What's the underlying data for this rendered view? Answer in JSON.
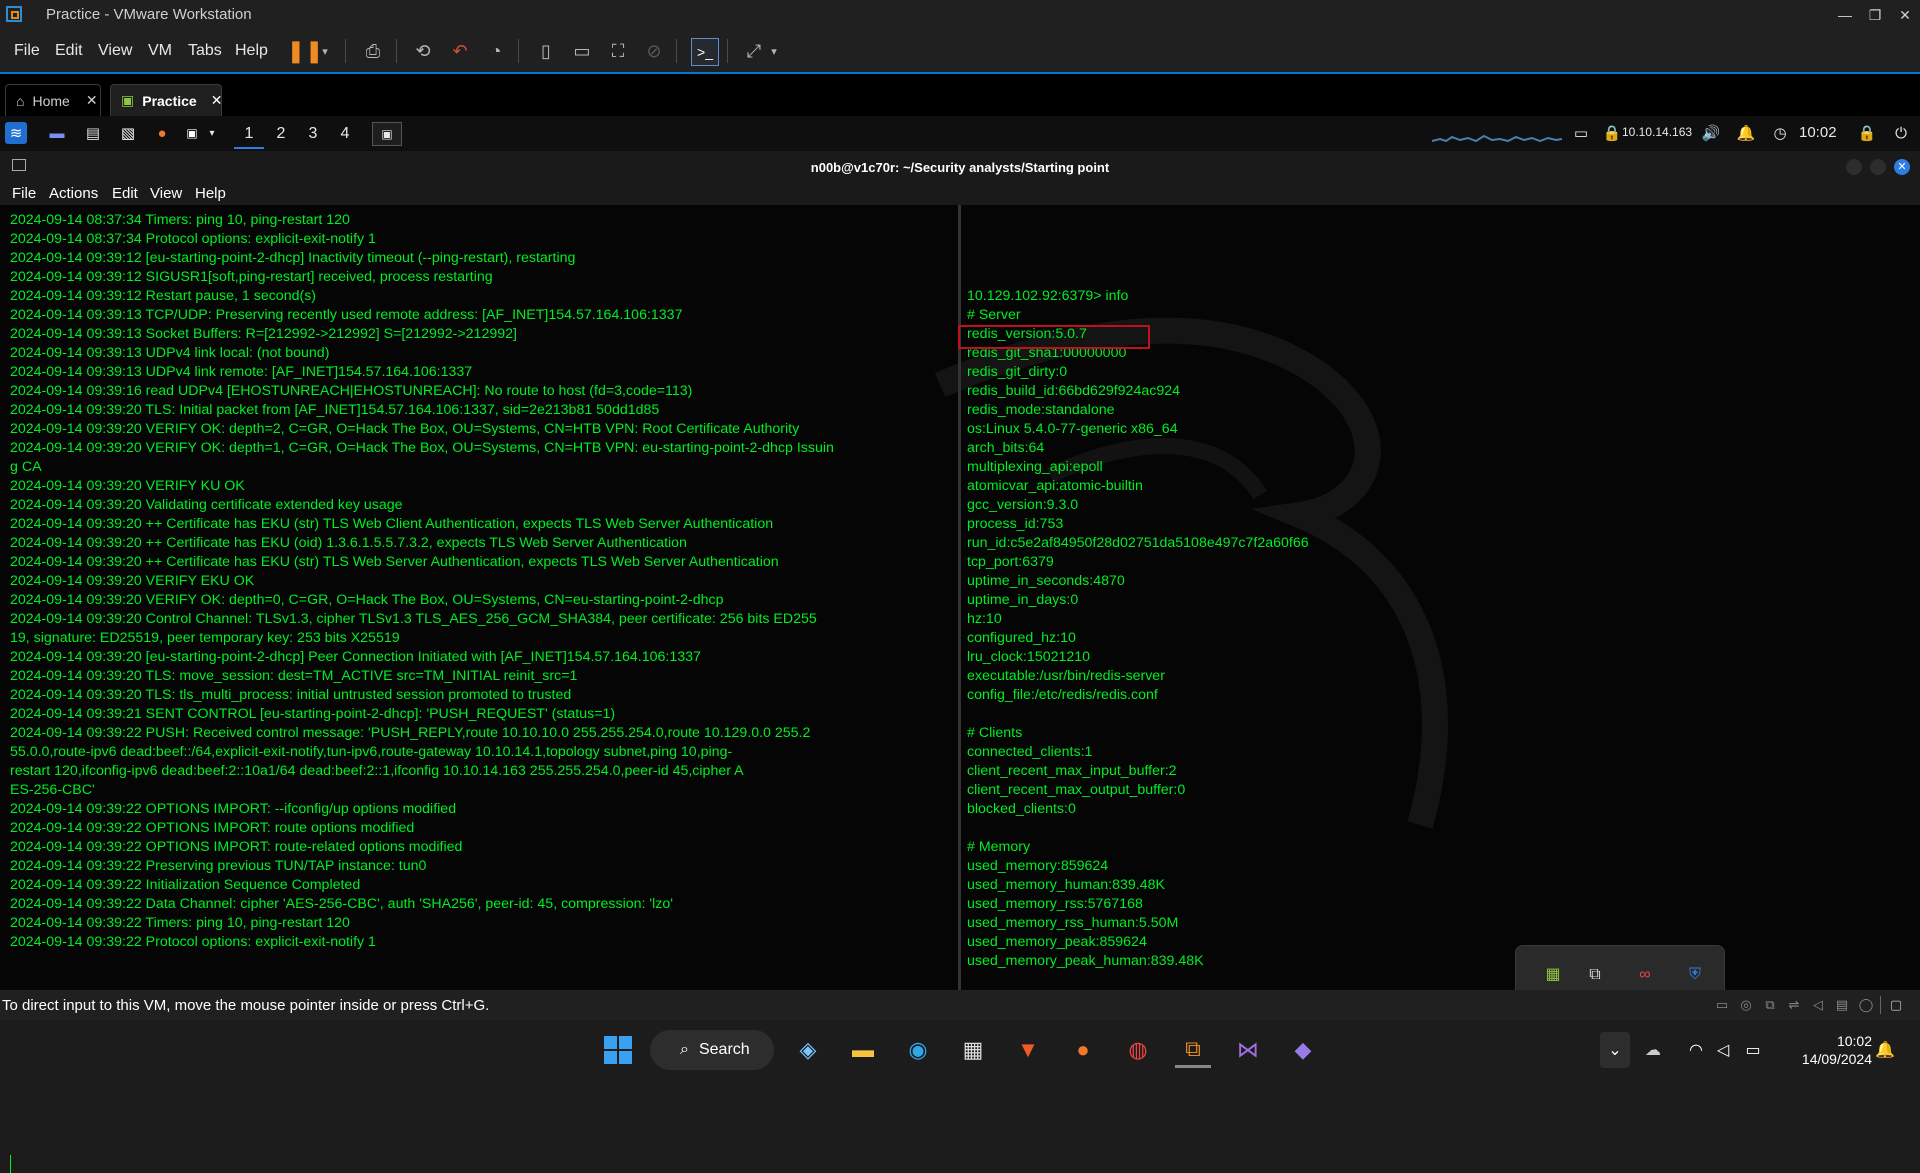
{
  "window": {
    "title": "Practice - VMware Workstation",
    "controls": [
      "—",
      "❐",
      "✕"
    ]
  },
  "vm_menu": [
    "File",
    "Edit",
    "View",
    "VM",
    "Tabs",
    "Help"
  ],
  "vm_tabs": [
    {
      "label": "Home",
      "icon": "home-icon",
      "active": false
    },
    {
      "label": "Practice",
      "icon": "vm-icon",
      "active": true
    }
  ],
  "kali_panel": {
    "workspaces": [
      "1",
      "2",
      "3",
      "4"
    ],
    "ip": "10.10.14.163",
    "time": "10:02"
  },
  "terminal": {
    "title": "n00b@v1c70r: ~/Security analysts/Starting point",
    "menu": [
      "File",
      "Actions",
      "Edit",
      "View",
      "Help"
    ],
    "left_lines": [
      "2024-09-14 08:37:34 Timers: ping 10, ping-restart 120",
      "2024-09-14 08:37:34 Protocol options: explicit-exit-notify 1",
      "2024-09-14 09:39:12 [eu-starting-point-2-dhcp] Inactivity timeout (--ping-restart), restarting",
      "2024-09-14 09:39:12 SIGUSR1[soft,ping-restart] received, process restarting",
      "2024-09-14 09:39:12 Restart pause, 1 second(s)",
      "2024-09-14 09:39:13 TCP/UDP: Preserving recently used remote address: [AF_INET]154.57.164.106:1337",
      "2024-09-14 09:39:13 Socket Buffers: R=[212992->212992] S=[212992->212992]",
      "2024-09-14 09:39:13 UDPv4 link local: (not bound)",
      "2024-09-14 09:39:13 UDPv4 link remote: [AF_INET]154.57.164.106:1337",
      "2024-09-14 09:39:16 read UDPv4 [EHOSTUNREACH|EHOSTUNREACH]: No route to host (fd=3,code=113)",
      "2024-09-14 09:39:20 TLS: Initial packet from [AF_INET]154.57.164.106:1337, sid=2e213b81 50dd1d85",
      "2024-09-14 09:39:20 VERIFY OK: depth=2, C=GR, O=Hack The Box, OU=Systems, CN=HTB VPN: Root Certificate Authority",
      "2024-09-14 09:39:20 VERIFY OK: depth=1, C=GR, O=Hack The Box, OU=Systems, CN=HTB VPN: eu-starting-point-2-dhcp Issuin",
      "g CA",
      "2024-09-14 09:39:20 VERIFY KU OK",
      "2024-09-14 09:39:20 Validating certificate extended key usage",
      "2024-09-14 09:39:20 ++ Certificate has EKU (str) TLS Web Client Authentication, expects TLS Web Server Authentication",
      "2024-09-14 09:39:20 ++ Certificate has EKU (oid) 1.3.6.1.5.5.7.3.2, expects TLS Web Server Authentication",
      "2024-09-14 09:39:20 ++ Certificate has EKU (str) TLS Web Server Authentication, expects TLS Web Server Authentication",
      "2024-09-14 09:39:20 VERIFY EKU OK",
      "2024-09-14 09:39:20 VERIFY OK: depth=0, C=GR, O=Hack The Box, OU=Systems, CN=eu-starting-point-2-dhcp",
      "2024-09-14 09:39:20 Control Channel: TLSv1.3, cipher TLSv1.3 TLS_AES_256_GCM_SHA384, peer certificate: 256 bits ED255",
      "19, signature: ED25519, peer temporary key: 253 bits X25519",
      "2024-09-14 09:39:20 [eu-starting-point-2-dhcp] Peer Connection Initiated with [AF_INET]154.57.164.106:1337",
      "2024-09-14 09:39:20 TLS: move_session: dest=TM_ACTIVE src=TM_INITIAL reinit_src=1",
      "2024-09-14 09:39:20 TLS: tls_multi_process: initial untrusted session promoted to trusted",
      "2024-09-14 09:39:21 SENT CONTROL [eu-starting-point-2-dhcp]: 'PUSH_REQUEST' (status=1)",
      "2024-09-14 09:39:22 PUSH: Received control message: 'PUSH_REPLY,route 10.10.10.0 255.255.254.0,route 10.129.0.0 255.2",
      "55.0.0,route-ipv6 dead:beef::/64,explicit-exit-notify,tun-ipv6,route-gateway 10.10.14.1,topology subnet,ping 10,ping-",
      "restart 120,ifconfig-ipv6 dead:beef:2::10a1/64 dead:beef:2::1,ifconfig 10.10.14.163 255.255.254.0,peer-id 45,cipher A",
      "ES-256-CBC'",
      "2024-09-14 09:39:22 OPTIONS IMPORT: --ifconfig/up options modified",
      "2024-09-14 09:39:22 OPTIONS IMPORT: route options modified",
      "2024-09-14 09:39:22 OPTIONS IMPORT: route-related options modified",
      "2024-09-14 09:39:22 Preserving previous TUN/TAP instance: tun0",
      "2024-09-14 09:39:22 Initialization Sequence Completed",
      "2024-09-14 09:39:22 Data Channel: cipher 'AES-256-CBC', auth 'SHA256', peer-id: 45, compression: 'lzo'",
      "2024-09-14 09:39:22 Timers: ping 10, ping-restart 120",
      "2024-09-14 09:39:22 Protocol options: explicit-exit-notify 1"
    ],
    "right_lines": [
      "10.129.102.92:6379> info",
      "# Server",
      "redis_version:5.0.7",
      "redis_git_sha1:00000000",
      "redis_git_dirty:0",
      "redis_build_id:66bd629f924ac924",
      "redis_mode:standalone",
      "os:Linux 5.4.0-77-generic x86_64",
      "arch_bits:64",
      "multiplexing_api:epoll",
      "atomicvar_api:atomic-builtin",
      "gcc_version:9.3.0",
      "process_id:753",
      "run_id:c5e2af84950f28d02751da5108e497c7f2a60f66",
      "tcp_port:6379",
      "uptime_in_seconds:4870",
      "uptime_in_days:0",
      "hz:10",
      "configured_hz:10",
      "lru_clock:15021210",
      "executable:/usr/bin/redis-server",
      "config_file:/etc/redis/redis.conf",
      "",
      "# Clients",
      "connected_clients:1",
      "client_recent_max_input_buffer:2",
      "client_recent_max_output_buffer:0",
      "blocked_clients:0",
      "",
      "# Memory",
      "used_memory:859624",
      "used_memory_human:839.48K",
      "used_memory_rss:5767168",
      "used_memory_rss_human:5.50M",
      "used_memory_peak:859624",
      "used_memory_peak_human:839.48K"
    ]
  },
  "status_bar": {
    "text": "To direct input to this VM, move the mouse pointer inside or press Ctrl+G."
  },
  "taskbar": {
    "search_label": "Search",
    "time": "10:02",
    "date": "14/09/2024"
  },
  "colors": {
    "terminal_text": "#00ee22",
    "highlight_box": "#c0101d",
    "accent": "#0078d4"
  }
}
